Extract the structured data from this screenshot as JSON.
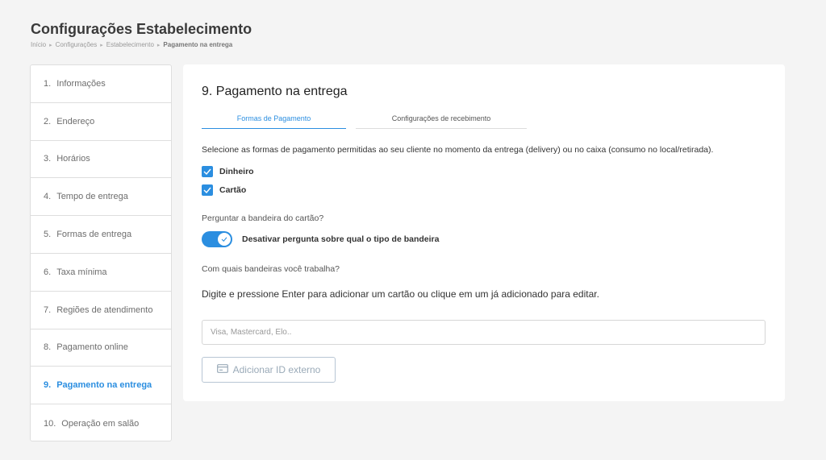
{
  "header": {
    "title": "Configurações Estabelecimento",
    "breadcrumb": [
      "Início",
      "Configurações",
      "Estabelecimento",
      "Pagamento na entrega"
    ]
  },
  "sidebar": {
    "items": [
      {
        "num": "1.",
        "label": "Informações"
      },
      {
        "num": "2.",
        "label": "Endereço"
      },
      {
        "num": "3.",
        "label": "Horários"
      },
      {
        "num": "4.",
        "label": "Tempo de entrega"
      },
      {
        "num": "5.",
        "label": "Formas de entrega"
      },
      {
        "num": "6.",
        "label": "Taxa mínima"
      },
      {
        "num": "7.",
        "label": "Regiões de atendimento"
      },
      {
        "num": "8.",
        "label": "Pagamento online"
      },
      {
        "num": "9.",
        "label": "Pagamento na entrega"
      },
      {
        "num": "10.",
        "label": "Operação em salão"
      }
    ],
    "active_index": 8
  },
  "main": {
    "title": "9. Pagamento na entrega",
    "tabs": [
      {
        "label": "Formas de Pagamento",
        "active": true
      },
      {
        "label": "Configurações de recebimento",
        "active": false
      }
    ],
    "description": "Selecione as formas de pagamento permitidas ao seu cliente no momento da entrega (delivery) ou no caixa (consumo no local/retirada).",
    "payment_methods": [
      {
        "label": "Dinheiro",
        "checked": true
      },
      {
        "label": "Cartão",
        "checked": true
      }
    ],
    "ask_brand_question": "Perguntar a bandeira do cartão?",
    "toggle": {
      "label": "Desativar pergunta sobre qual o tipo de bandeira",
      "on": true
    },
    "brands_question": "Com quais bandeiras você trabalha?",
    "instruction": "Digite e pressione Enter para adicionar um cartão ou clique em um já adicionado para editar.",
    "brand_input": {
      "placeholder": "Visa, Mastercard, Elo..",
      "value": ""
    },
    "external_id_button": "Adicionar ID externo"
  },
  "colors": {
    "accent": "#2b8ee0",
    "background": "#f4f4f4",
    "card": "#ffffff"
  },
  "icons": {
    "checkbox": "check-icon",
    "toggle_knob": "check-icon",
    "external_button": "card-icon"
  }
}
